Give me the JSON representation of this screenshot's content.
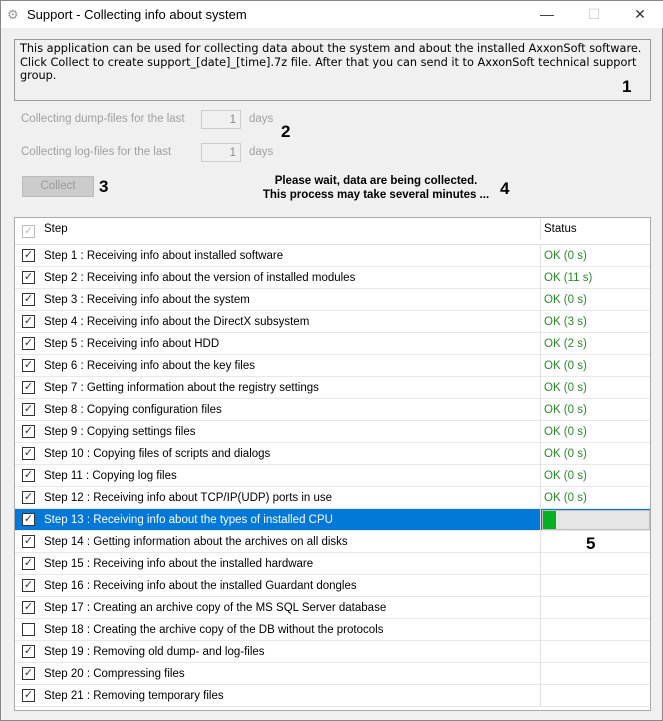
{
  "window": {
    "title": "Support - Collecting info about system",
    "icon": "gears-icon"
  },
  "info_text": "This application can be used for collecting data about the system and about the installed AxxonSoft software. Click Collect to create support_[date]_[time].7z file. After that you can send it to AxxonSoft technical support group.",
  "dump": {
    "label": "Collecting dump-files for the last",
    "value": "1",
    "unit": "days"
  },
  "log": {
    "label": "Collecting log-files for the last",
    "value": "1",
    "unit": "days"
  },
  "collect_label": "Collect",
  "wait_line1": "Please wait, data are being collected.",
  "wait_line2": "This process may take several minutes ...",
  "markers": [
    "1",
    "2",
    "3",
    "4",
    "5"
  ],
  "table": {
    "headers": {
      "step": "Step",
      "status": "Status"
    },
    "rows": [
      {
        "step": "Step 1 : Receiving info about installed software",
        "status": "OK (0 s)",
        "checked": true
      },
      {
        "step": "Step 2 : Receiving info about the version of installed modules",
        "status": "OK (11 s)",
        "checked": true
      },
      {
        "step": "Step 3 : Receiving info about the system",
        "status": "OK (0 s)",
        "checked": true
      },
      {
        "step": "Step 4 : Receiving info about the DirectX subsystem",
        "status": "OK (3 s)",
        "checked": true
      },
      {
        "step": "Step 5 : Receiving info about HDD",
        "status": "OK (2 s)",
        "checked": true
      },
      {
        "step": "Step 6 : Receiving info about the key files",
        "status": "OK (0 s)",
        "checked": true
      },
      {
        "step": "Step 7 : Getting information about the registry settings",
        "status": "OK (0 s)",
        "checked": true
      },
      {
        "step": "Step 8 : Copying configuration files",
        "status": "OK (0 s)",
        "checked": true
      },
      {
        "step": "Step 9 : Copying settings files",
        "status": "OK (0 s)",
        "checked": true
      },
      {
        "step": "Step 10 : Copying files of scripts and dialogs",
        "status": "OK (0 s)",
        "checked": true
      },
      {
        "step": "Step 11 : Copying log files",
        "status": "OK (0 s)",
        "checked": true
      },
      {
        "step": "Step 12 : Receiving info about TCP/IP(UDP) ports in use",
        "status": "OK (0 s)",
        "checked": true
      },
      {
        "step": "Step 13 : Receiving info about the types of installed CPU",
        "status": "",
        "checked": true,
        "selected": true,
        "progress": 12
      },
      {
        "step": "Step 14 : Getting information about the archives on all disks",
        "status": "",
        "checked": true
      },
      {
        "step": "Step 15 : Receiving info about the installed hardware",
        "status": "",
        "checked": true
      },
      {
        "step": "Step 16 : Receiving info about the installed Guardant dongles",
        "status": "",
        "checked": true
      },
      {
        "step": "Step 17 : Creating an archive copy of the MS SQL Server database",
        "status": "",
        "checked": true
      },
      {
        "step": "Step 18 : Creating the archive copy of the DB without the protocols",
        "status": "",
        "checked": false
      },
      {
        "step": "Step 19 : Removing old dump- and log-files",
        "status": "",
        "checked": true
      },
      {
        "step": "Step 20 : Compressing files",
        "status": "",
        "checked": true
      },
      {
        "step": "Step 21 : Removing temporary files",
        "status": "",
        "checked": true
      }
    ]
  }
}
